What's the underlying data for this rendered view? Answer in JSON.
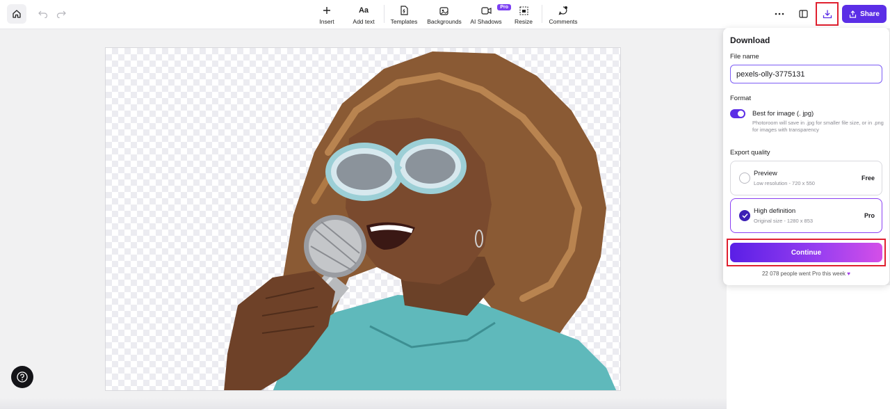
{
  "toolbar": {
    "tools": [
      {
        "label": "Insert",
        "icon": "plus-icon"
      },
      {
        "label": "Add text",
        "icon": "text-aa-icon"
      },
      {
        "label": "Templates",
        "icon": "templates-icon"
      },
      {
        "label": "Backgrounds",
        "icon": "backgrounds-icon"
      },
      {
        "label": "AI Shadows",
        "icon": "ai-shadows-icon",
        "badge": "Pro"
      },
      {
        "label": "Resize",
        "icon": "resize-icon"
      },
      {
        "label": "Comments",
        "icon": "comments-icon"
      }
    ],
    "share_label": "Share"
  },
  "download": {
    "title": "Download",
    "file_name_label": "File name",
    "file_name_value": "pexels-olly-3775131",
    "format_label": "Format",
    "format_title": "Best for image (. jpg)",
    "format_desc": "Photoroom will save in .jpg for smaller file size, or in .png for images with transparency",
    "export_quality_label": "Export quality",
    "options": [
      {
        "title": "Preview",
        "sub": "Low resolution - 720 x 550",
        "tag": "Free",
        "selected": false
      },
      {
        "title": "High definition",
        "sub": "Original size - 1280 x 853",
        "tag": "Pro",
        "selected": true
      }
    ],
    "continue_label": "Continue",
    "social_text": "22 078 people went Pro this week"
  },
  "colors": {
    "accent": "#5b2ee6",
    "highlight": "#e0202f",
    "pro_badge": "#7b3ff2"
  }
}
